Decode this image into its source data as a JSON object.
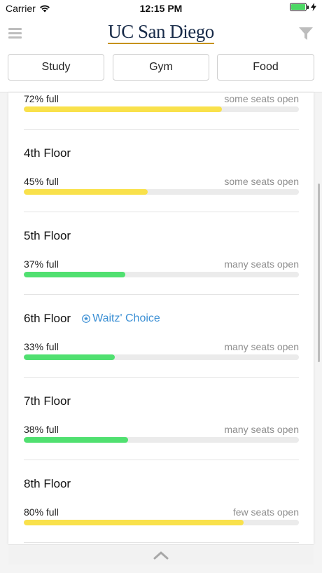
{
  "status_bar": {
    "carrier": "Carrier",
    "time": "12:15 PM"
  },
  "header": {
    "logo_text": "UC San Diego"
  },
  "tabs": [
    {
      "label": "Study"
    },
    {
      "label": "Gym"
    },
    {
      "label": "Food"
    }
  ],
  "floors": [
    {
      "name": "",
      "percent_label": "72% full",
      "fill": 0.72,
      "status": "some seats open",
      "color": "#f9e14b"
    },
    {
      "name": "4th Floor",
      "percent_label": "45% full",
      "fill": 0.45,
      "status": "some seats open",
      "color": "#f9e14b"
    },
    {
      "name": "5th Floor",
      "percent_label": "37% full",
      "fill": 0.37,
      "status": "many seats open",
      "color": "#50e070"
    },
    {
      "name": "6th Floor",
      "badge": "Waitz' Choice",
      "percent_label": "33% full",
      "fill": 0.33,
      "status": "many seats open",
      "color": "#50e070"
    },
    {
      "name": "7th Floor",
      "percent_label": "38% full",
      "fill": 0.38,
      "status": "many seats open",
      "color": "#50e070"
    },
    {
      "name": "8th Floor",
      "percent_label": "80% full",
      "fill": 0.8,
      "status": "few seats open",
      "color": "#f9e14b"
    }
  ],
  "colors": {
    "accent": "#3b8fd4",
    "brand_navy": "#182b49",
    "brand_gold": "#c69214"
  },
  "icons": {
    "menu": "hamburger-icon",
    "filter": "filter-icon",
    "expand": "chevron-up-icon",
    "choice": "star-badge-icon"
  }
}
